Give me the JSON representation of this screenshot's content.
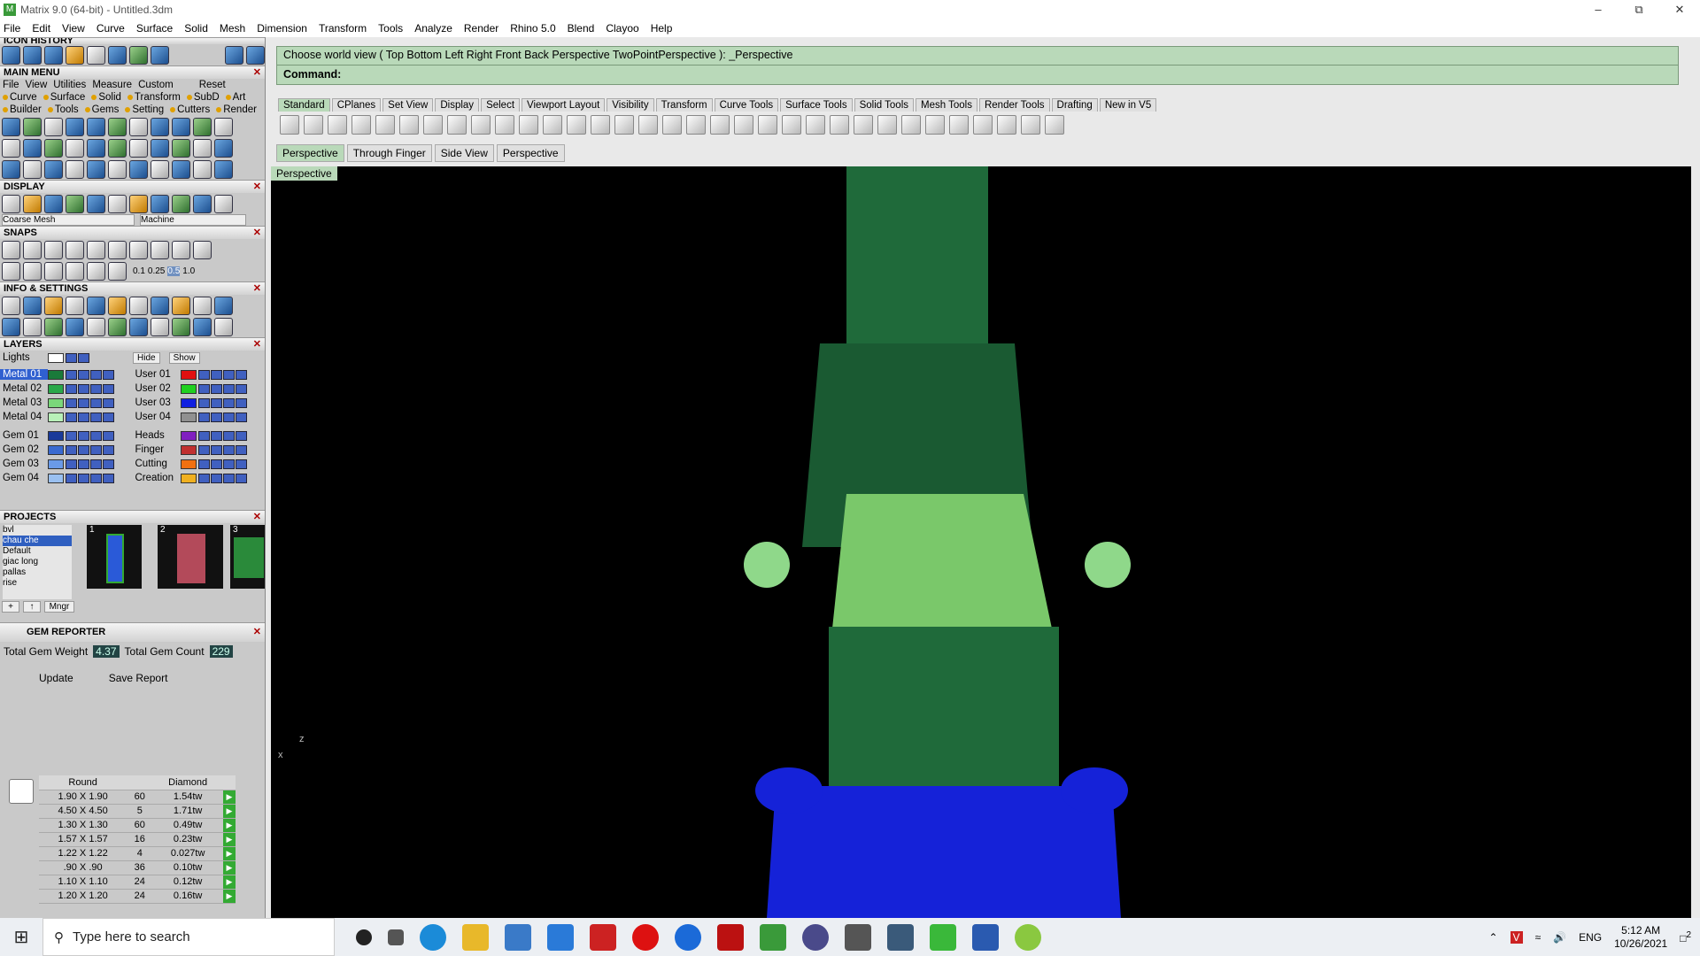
{
  "window": {
    "title": "Matrix 9.0 (64-bit) - Untitled.3dm",
    "app_icon_glyph": "M"
  },
  "menubar": [
    "File",
    "Edit",
    "View",
    "Curve",
    "Surface",
    "Solid",
    "Mesh",
    "Dimension",
    "Transform",
    "Tools",
    "Analyze",
    "Render",
    "Rhino 5.0",
    "Blend",
    "Clayoo",
    "Help"
  ],
  "left": {
    "icon_history_title": "ICON HISTORY",
    "main_menu": {
      "title": "MAIN MENU",
      "top": [
        "File",
        "View",
        "Utilities",
        "Measure",
        "Custom"
      ],
      "reset": "Reset",
      "row1": [
        "Curve",
        "Surface",
        "Solid",
        "Transform",
        "SubD",
        "Art"
      ],
      "row2": [
        "Builder",
        "Tools",
        "Gems",
        "Setting",
        "Cutters",
        "Render"
      ]
    },
    "display": {
      "title": "DISPLAY",
      "mesh": "Coarse Mesh",
      "material": "Machine"
    },
    "snaps": {
      "title": "SNAPS",
      "values": [
        "0.1",
        "0.25",
        "0.5",
        "1.0"
      ]
    },
    "info_title": "INFO & SETTINGS",
    "layers": {
      "title": "LAYERS",
      "lights": "Lights",
      "hide": "Hide",
      "show": "Show",
      "left": [
        {
          "name": "Metal 01",
          "color": "#1a7a3a",
          "sel": true
        },
        {
          "name": "Metal 02",
          "color": "#2aa84a"
        },
        {
          "name": "Metal 03",
          "color": "#7ad77a"
        },
        {
          "name": "Metal 04",
          "color": "#b8f0b8"
        },
        {
          "name": "Gem 01",
          "color": "#1a3a9a"
        },
        {
          "name": "Gem 02",
          "color": "#3a6ad0"
        },
        {
          "name": "Gem 03",
          "color": "#6a9ae8"
        },
        {
          "name": "Gem 04",
          "color": "#9ac0f0"
        }
      ],
      "right": [
        {
          "name": "User 01",
          "color": "#e01010"
        },
        {
          "name": "User 02",
          "color": "#20d020"
        },
        {
          "name": "User 03",
          "color": "#1020e0"
        },
        {
          "name": "User 04",
          "color": "#909090"
        },
        {
          "name": "Heads",
          "color": "#8020c0"
        },
        {
          "name": "Finger",
          "color": "#c03030"
        },
        {
          "name": "Cutting",
          "color": "#f07010"
        },
        {
          "name": "Creation",
          "color": "#f0b020"
        }
      ]
    },
    "projects": {
      "title": "PROJECTS",
      "list": [
        "bvl",
        "chau che",
        "Default",
        "giac long",
        "pallas",
        "rise"
      ],
      "thumbs": [
        "1",
        "2",
        "3"
      ],
      "mngr": "Mngr"
    },
    "gem_reporter": {
      "title": "GEM REPORTER",
      "weight_label": "Total Gem Weight",
      "weight": "4.37",
      "count_label": "Total Gem Count",
      "count": "229",
      "update": "Update",
      "save": "Save Report",
      "cols": [
        "Round",
        "Diamond"
      ],
      "rows": [
        [
          "1.90 X 1.90",
          "60",
          "1.54tw"
        ],
        [
          "4.50 X 4.50",
          "5",
          "1.71tw"
        ],
        [
          "1.30 X 1.30",
          "60",
          "0.49tw"
        ],
        [
          "1.57 X 1.57",
          "16",
          "0.23tw"
        ],
        [
          "1.22 X 1.22",
          "4",
          "0.027tw"
        ],
        [
          ".90 X .90",
          "36",
          "0.10tw"
        ],
        [
          "1.10 X 1.10",
          "24",
          "0.12tw"
        ],
        [
          "1.20 X 1.20",
          "24",
          "0.16tw"
        ]
      ]
    }
  },
  "command": {
    "prompt": "Choose world view ( Top  Bottom  Left  Right  Front  Back  Perspective  TwoPointPerspective ): _Perspective",
    "label": "Command:"
  },
  "toolbar_tabs": [
    "Standard",
    "CPlanes",
    "Set View",
    "Display",
    "Select",
    "Viewport Layout",
    "Visibility",
    "Transform",
    "Curve Tools",
    "Surface Tools",
    "Solid Tools",
    "Mesh Tools",
    "Render Tools",
    "Drafting",
    "New in V5"
  ],
  "view_tabs": [
    "Perspective",
    "Through Finger",
    "Side View",
    "Perspective"
  ],
  "viewport": {
    "label": "Perspective",
    "axis_z": "z",
    "axis_x": "x"
  },
  "taskbar": {
    "search": "Type here to search",
    "lang": "ENG",
    "time": "5:12 AM",
    "date": "10/26/2021",
    "notif": "2"
  }
}
